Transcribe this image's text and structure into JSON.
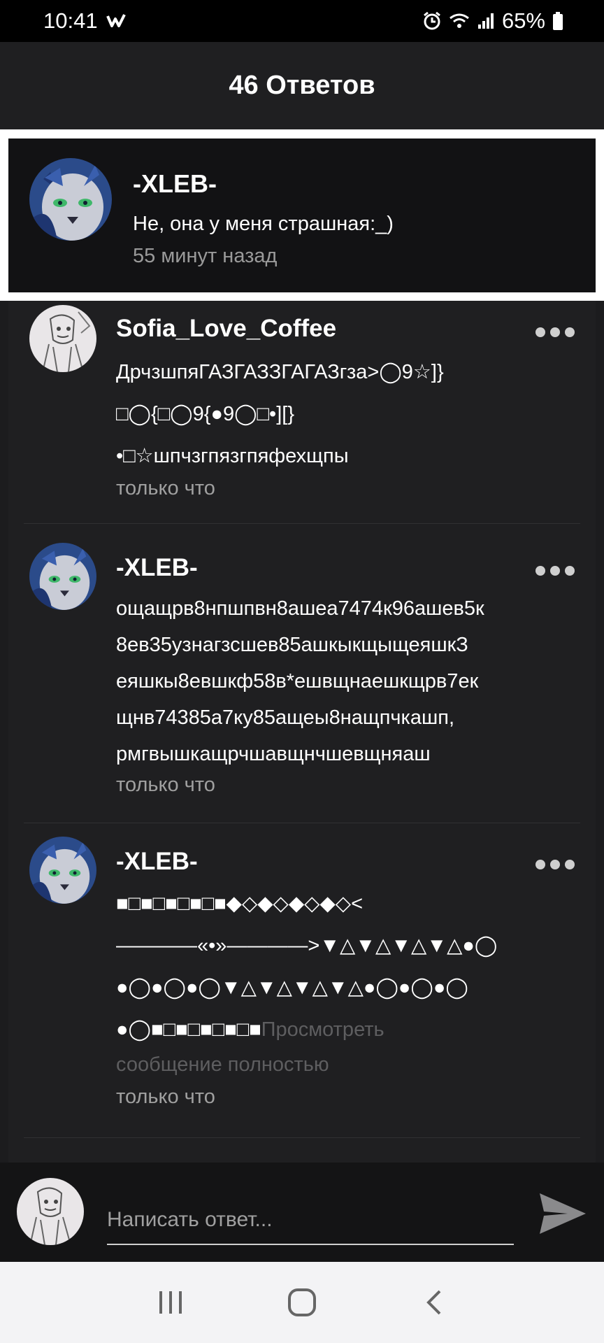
{
  "status": {
    "time": "10:41",
    "battery": "65%"
  },
  "header": {
    "title": "46 Ответов"
  },
  "parent": {
    "name": "-XLEB-",
    "text": "Не, она у меня страшная:_)",
    "time": "55 минут назад"
  },
  "comments": [
    {
      "name": "Sofia_Love_Coffee",
      "lines": [
        "ДрчзшпяГАЗГАЗЗГАГАЗгза>◯9☆]}",
        "□◯{□◯9{●9◯□•][}",
        "•□☆шпчзгпязгпяфехщпы"
      ],
      "time": "только что"
    },
    {
      "name": "-XLEB-",
      "lines": [
        "ощащрв8нпшпвн8ашеа7474к96ашев5к",
        "8ев35узнагзсшев85ашкыкщыщеяшкЗ",
        "еяшкы8евшкф58в*ешвщнаешкщрв7ек",
        "щнв74385а7ку85ащеы8нащпчкашп,",
        "рмгвышкащрчшавщнчшевщняаш"
      ],
      "time": "только что"
    },
    {
      "name": "-XLEB-",
      "lines": [
        "■□■□■□■□■◆◇◆◇◆◇◆◇<",
        "————«•»————>▼△▼△▼△▼△●◯",
        "●◯●◯●◯▼△▼△▼△▼△●◯●◯●◯",
        "●◯■□■□■□■□■"
      ],
      "view_full_line1": "Просмотреть",
      "view_full_line2": "сообщение полностью",
      "time": "только что"
    }
  ],
  "reply": {
    "placeholder": "Написать ответ..."
  },
  "icons": {
    "more": "more-dots-icon",
    "send": "send-icon",
    "nav_recents": "recents-icon",
    "nav_home": "home-icon",
    "nav_back": "back-icon"
  }
}
